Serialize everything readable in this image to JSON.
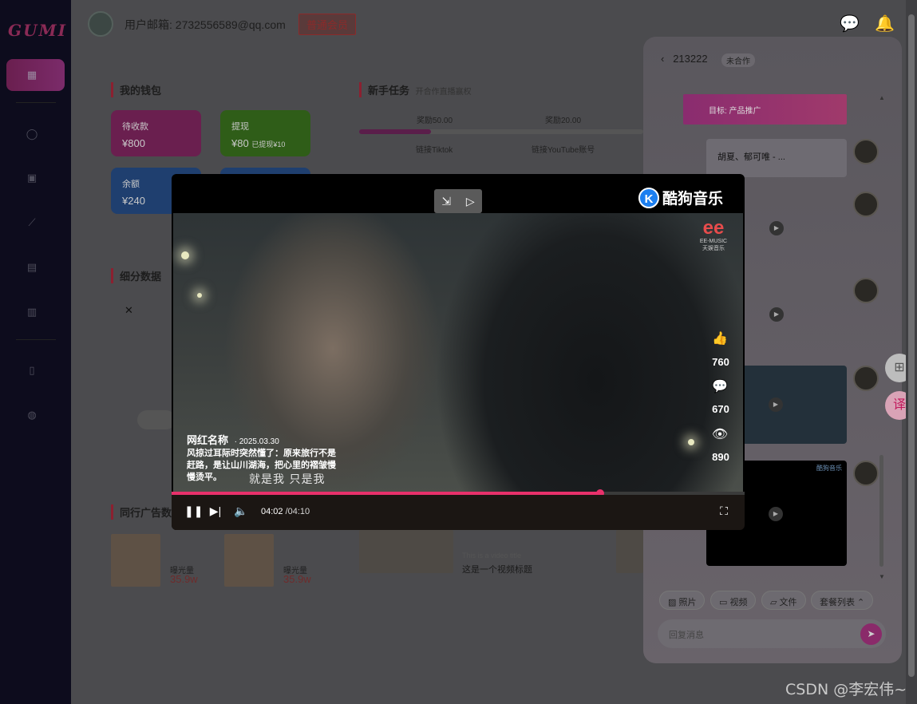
{
  "app": {
    "logo_text": "GUMI"
  },
  "header": {
    "user_email": "用户邮箱: 2732556589@qq.com",
    "member_badge": "普通会员",
    "chat_icon": "chat-bubble-icon",
    "bell_icon": "bell-icon"
  },
  "sidebar": {
    "items": [
      {
        "icon": "dashboard-icon",
        "active": true
      },
      {
        "icon": "user-icon"
      },
      {
        "icon": "chart-icon"
      },
      {
        "icon": "trend-icon"
      },
      {
        "icon": "document-icon"
      },
      {
        "icon": "bar-chart-icon"
      },
      {
        "icon": "book-icon"
      },
      {
        "icon": "globe-icon"
      }
    ]
  },
  "wallet": {
    "title": "我的钱包",
    "cards": [
      {
        "label": "待收款",
        "value": "¥800",
        "color": "#6a1f4f"
      },
      {
        "label": "提现",
        "value": "¥80",
        "extra": "已提现¥10",
        "color": "#2f5d18"
      },
      {
        "label": "余额",
        "value": "¥240",
        "color": "#1f3f6f"
      }
    ]
  },
  "tasks": {
    "title": "新手任务",
    "subtitle": "开合作直播赢权",
    "reward1": "奖励50.00",
    "reward2": "奖励20.00",
    "task1": "链接Tiktok",
    "task2": "链接YouTube账号"
  },
  "segments": {
    "title": "细分数据"
  },
  "peer_ads": {
    "title": "同行广告数",
    "items": [
      {
        "label": "曝光量",
        "value": "35.9w"
      },
      {
        "label": "曝光量",
        "value": "35.9w"
      }
    ],
    "video_title_en": "This is a video title",
    "video_title": "这是一个视频标题"
  },
  "chat": {
    "contact": "213222",
    "status": "未合作",
    "goal": "目标: 产品推广",
    "song_card": "胡夏、郁可唯 - ...",
    "tools": [
      "照片",
      "视频",
      "文件",
      "套餐列表"
    ],
    "reply_placeholder": "回复消息",
    "brand_small": "酷狗音乐"
  },
  "video": {
    "brand": "酷狗音乐",
    "brand_icon_letter": "K",
    "ee_logo": "EE-MUSIC",
    "ee_logo_cn": "天娱音乐",
    "author": "网红名称",
    "date": "· 2025.03.30",
    "description": "风掠过耳际时突然懂了：原来旅行不是赶路，是让山川湖海，把心里的褶皱慢慢烫平。",
    "subtitle": "就是我  只是我",
    "likes": "760",
    "comments": "670",
    "views": "890",
    "current_time": "04:02",
    "duration": " /04:10",
    "progress": 0.748
  },
  "watermark": "CSDN @李宏伟~"
}
